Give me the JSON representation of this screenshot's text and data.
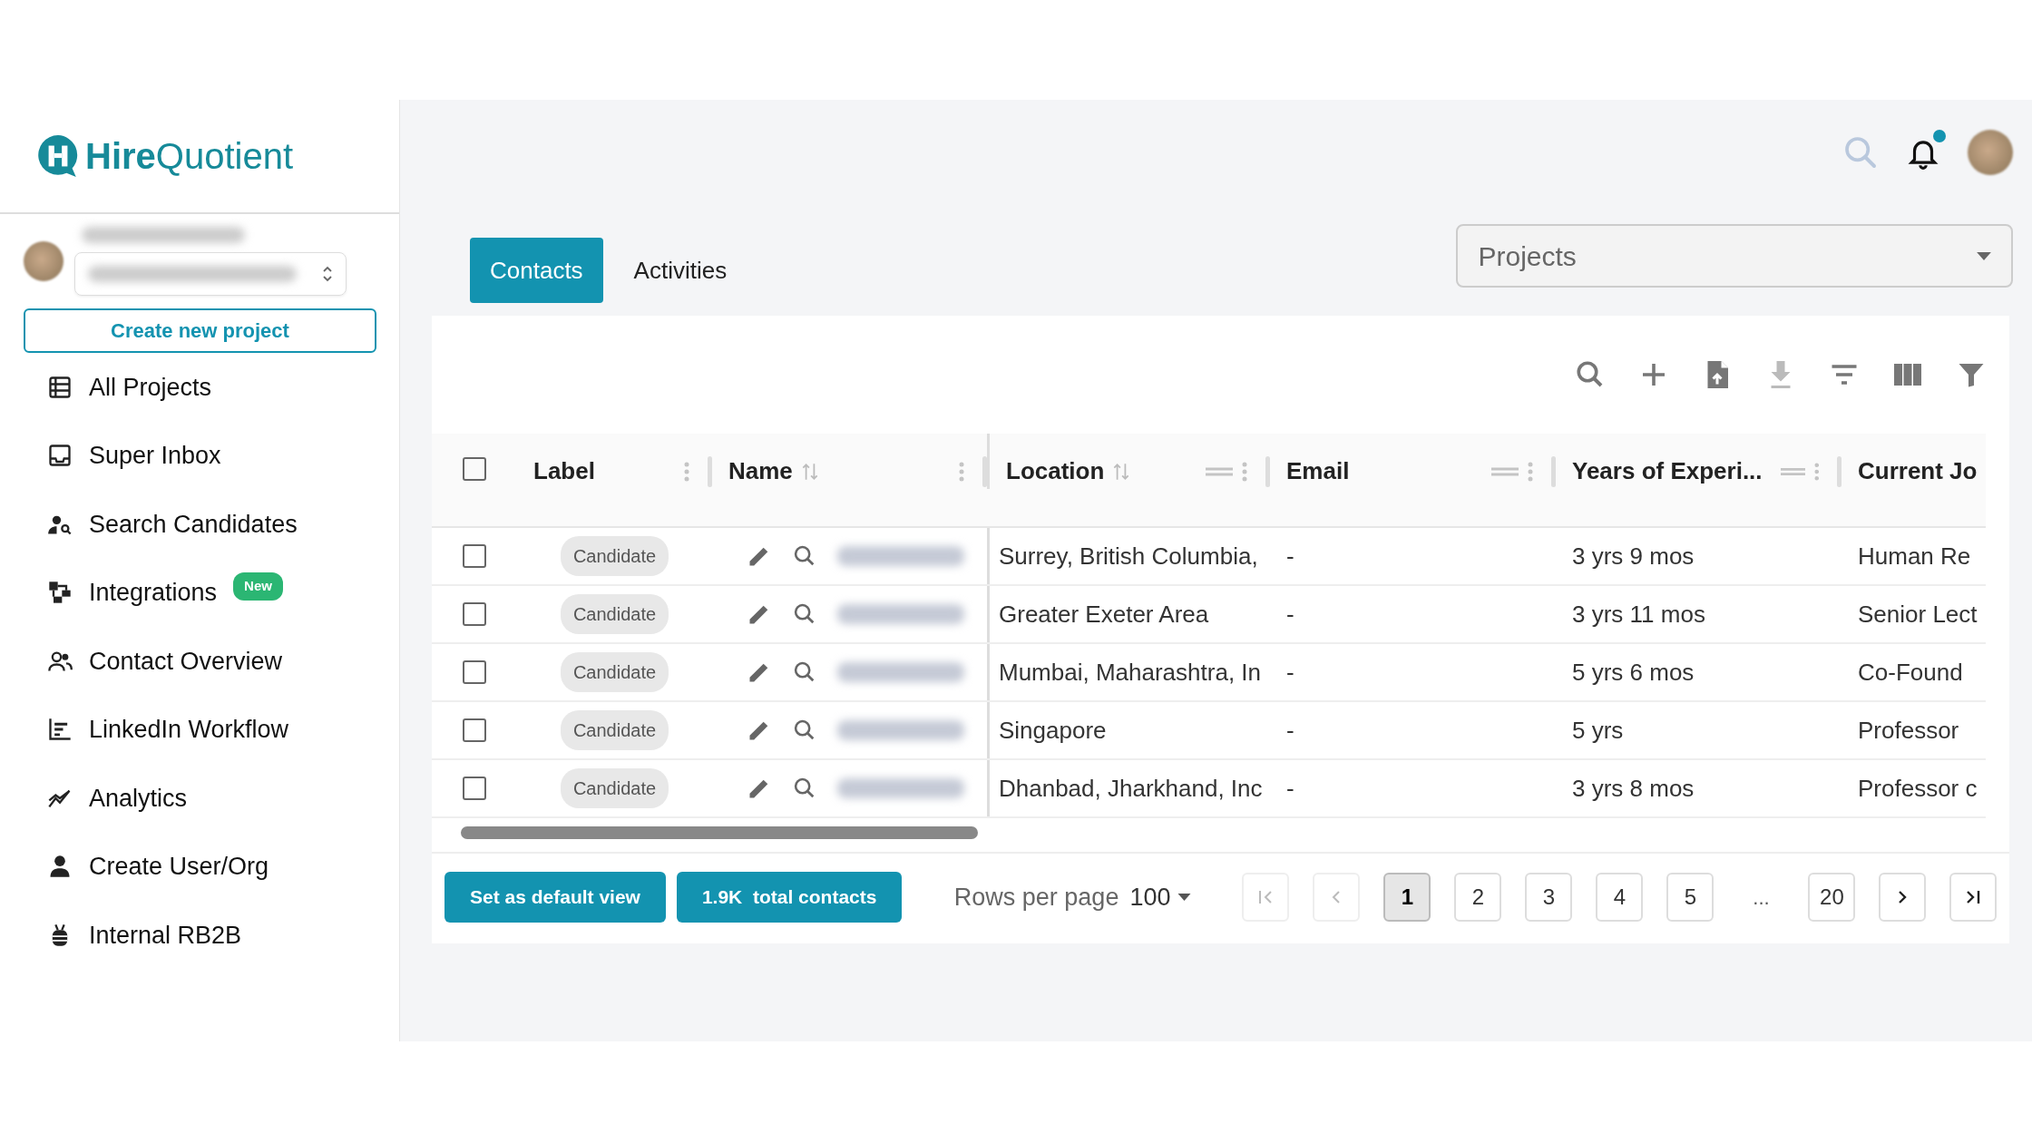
{
  "logo": {
    "brand_bold": "Hire",
    "brand_light": "Quotient"
  },
  "sidebar": {
    "create_button": "Create new project",
    "items": [
      {
        "label": "All Projects"
      },
      {
        "label": "Super Inbox"
      },
      {
        "label": "Search Candidates"
      },
      {
        "label": "Integrations",
        "badge": "New"
      },
      {
        "label": "Contact Overview"
      },
      {
        "label": "LinkedIn Workflow"
      },
      {
        "label": "Analytics"
      },
      {
        "label": "Create User/Org"
      },
      {
        "label": "Internal RB2B"
      }
    ]
  },
  "topbar": {
    "has_notification": true
  },
  "tabs": [
    {
      "label": "Contacts",
      "selected": true
    },
    {
      "label": "Activities",
      "selected": false
    }
  ],
  "project_select": {
    "placeholder": "Projects"
  },
  "table": {
    "all_checked": false,
    "columns": [
      {
        "label": "Label",
        "sortable": false,
        "draggable": false,
        "menu": true
      },
      {
        "label": "Name",
        "sortable": true,
        "draggable": false,
        "menu": true
      },
      {
        "label": "Location",
        "sortable": true,
        "draggable": true,
        "menu": true
      },
      {
        "label": "Email",
        "sortable": false,
        "draggable": true,
        "menu": true
      },
      {
        "label": "Years of Experi...",
        "sortable": false,
        "draggable": true,
        "menu": true
      },
      {
        "label": "Current Jo",
        "sortable": false,
        "draggable": false,
        "menu": false
      }
    ],
    "rows": [
      {
        "checked": false,
        "label": "Candidate",
        "location": "Surrey, British Columbia,",
        "email": "-",
        "experience": "3 yrs 9 mos",
        "current_job": "Human Re"
      },
      {
        "checked": false,
        "label": "Candidate",
        "location": "Greater Exeter Area",
        "email": "-",
        "experience": "3 yrs 11 mos",
        "current_job": "Senior Lect"
      },
      {
        "checked": false,
        "label": "Candidate",
        "location": "Mumbai, Maharashtra, In",
        "email": "-",
        "experience": "5 yrs 6 mos",
        "current_job": "Co-Found"
      },
      {
        "checked": false,
        "label": "Candidate",
        "location": "Singapore",
        "email": "-",
        "experience": "5 yrs",
        "current_job": "Professor"
      },
      {
        "checked": false,
        "label": "Candidate",
        "location": "Dhanbad, Jharkhand, Inc",
        "email": "-",
        "experience": "3 yrs 8 mos",
        "current_job": "Professor c"
      }
    ]
  },
  "footer": {
    "default_button": "Set as default view",
    "total_button": "1.9K  total contacts",
    "rows_label": "Rows per page",
    "rows_value": "100",
    "nav": [
      {
        "kind": "first",
        "disabled": true
      },
      {
        "kind": "prev",
        "disabled": true
      },
      {
        "kind": "next",
        "disabled": false
      },
      {
        "kind": "last",
        "disabled": false
      }
    ],
    "pages": [
      {
        "label": "1",
        "kind": "page",
        "selected": true
      },
      {
        "label": "2",
        "kind": "page",
        "selected": false
      },
      {
        "label": "3",
        "kind": "page",
        "selected": false
      },
      {
        "label": "4",
        "kind": "page",
        "selected": false
      },
      {
        "label": "5",
        "kind": "page",
        "selected": false
      },
      {
        "label": "...",
        "kind": "ellipsis"
      },
      {
        "label": "20",
        "kind": "page",
        "selected": false
      }
    ]
  }
}
